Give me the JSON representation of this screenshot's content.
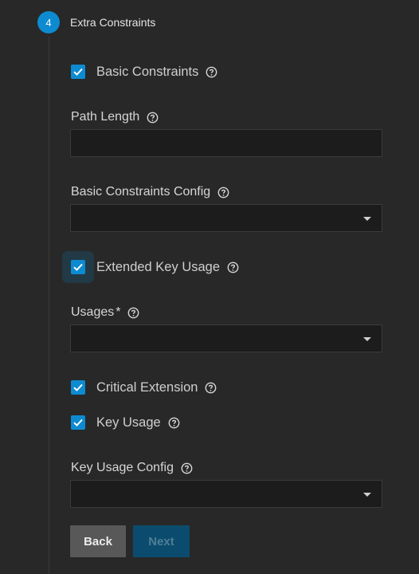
{
  "step": {
    "number": "4",
    "title": "Extra Constraints"
  },
  "fields": {
    "basic_constraints_label": "Basic Constraints",
    "path_length_label": "Path Length",
    "path_length_value": "",
    "basic_constraints_config_label": "Basic Constraints Config",
    "basic_constraints_config_value": "",
    "extended_key_usage_label": "Extended Key Usage",
    "usages_label": "Usages",
    "usages_required_mark": "*",
    "usages_value": "",
    "critical_extension_label": "Critical Extension",
    "key_usage_label": "Key Usage",
    "key_usage_config_label": "Key Usage Config",
    "key_usage_config_value": ""
  },
  "checkbox_states": {
    "basic_constraints": true,
    "extended_key_usage": true,
    "critical_extension": true,
    "key_usage": true
  },
  "buttons": {
    "back_label": "Back",
    "next_label": "Next",
    "next_enabled": false
  },
  "colors": {
    "accent": "#0d8bd1",
    "background": "#282828",
    "field_background": "#1c1c1c"
  },
  "icons": {
    "help": "help-circle-icon",
    "checkmark": "check-icon",
    "dropdown": "caret-down-icon"
  }
}
